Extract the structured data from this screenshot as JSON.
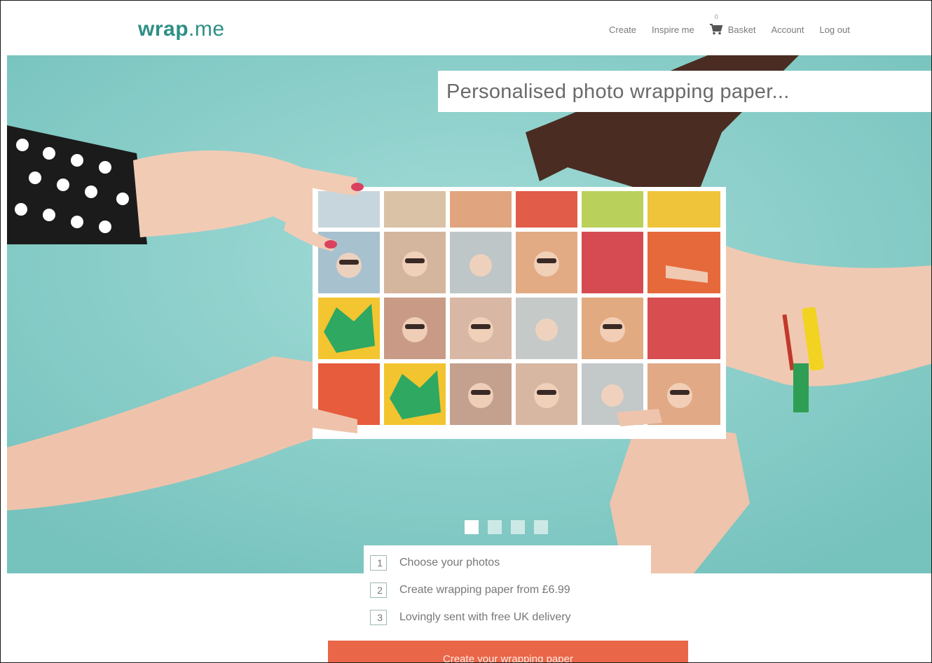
{
  "header": {
    "logo_bold": "wrap",
    "logo_light": ".me",
    "nav": {
      "create": "Create",
      "inspire": "Inspire me",
      "basket": "Basket",
      "basket_count": "0",
      "account": "Account",
      "logout": "Log out"
    }
  },
  "hero": {
    "headline": "Personalised photo wrapping paper...",
    "slides": 4,
    "active_slide": 1
  },
  "steps": [
    {
      "num": "1",
      "text": "Choose your photos"
    },
    {
      "num": "2",
      "text": "Create wrapping paper from £6.99"
    },
    {
      "num": "3",
      "text": "Lovingly sent with free UK delivery"
    }
  ],
  "cta": {
    "label": "Create your wrapping paper"
  },
  "colors": {
    "brand": "#2e8f85",
    "hero_bg": "#8fd0cc",
    "cta": "#e96648"
  },
  "icons": {
    "basket": "cart-icon"
  }
}
